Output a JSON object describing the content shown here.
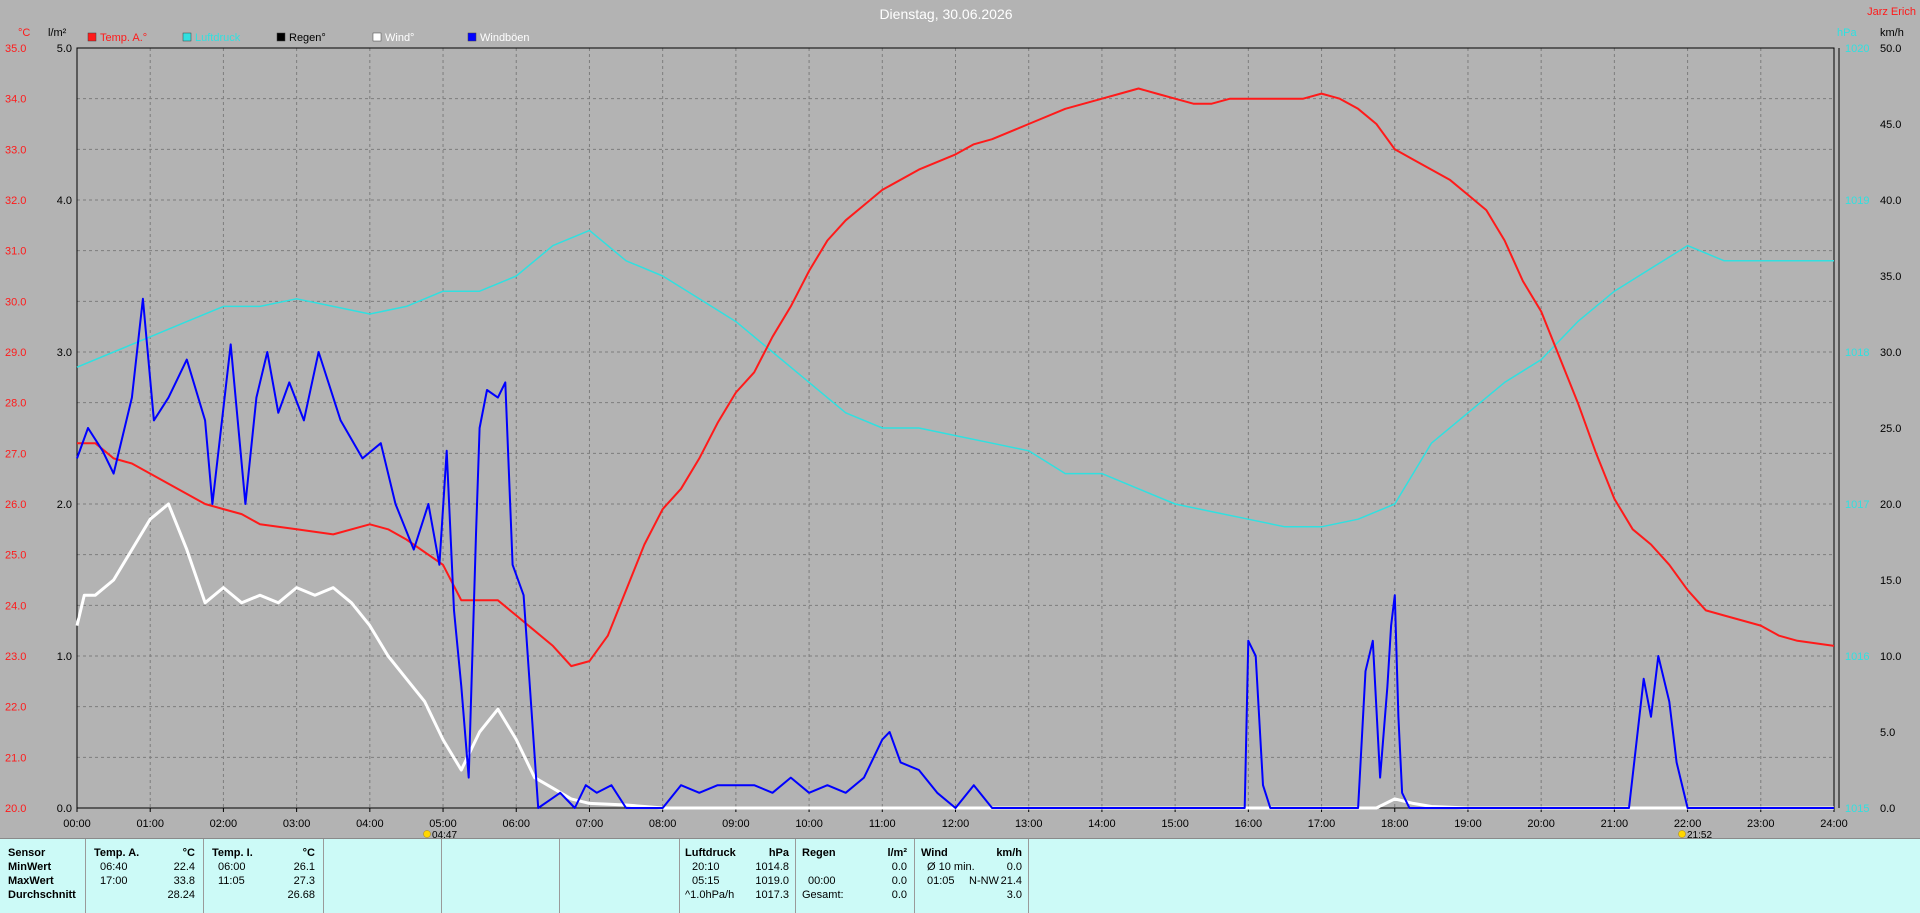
{
  "header": {
    "title": "Dienstag, 30.06.2026",
    "user": "Jarz Erich"
  },
  "legend": [
    {
      "label": "Temp. A.°",
      "color": "#ff1a1a",
      "text_color": "#ff1a1a"
    },
    {
      "label": "Luftdruck",
      "color": "#30e0e0",
      "text_color": "#30e0e0"
    },
    {
      "label": "Regen°",
      "color": "#000000",
      "text_color": "#000000"
    },
    {
      "label": "Wind°",
      "color": "#ffffff",
      "text_color": "#ffffff"
    },
    {
      "label": "Windböen",
      "color": "#0000ff",
      "text_color": "#ffffff"
    }
  ],
  "axes": {
    "left_temp_unit": "°C",
    "left_rain_unit": "l/m²",
    "right_pressure_unit": "hPa",
    "right_wind_unit": "km/h",
    "temp_ticks": [
      "35.0",
      "34.0",
      "33.0",
      "32.0",
      "31.0",
      "30.0",
      "29.0",
      "28.0",
      "27.0",
      "26.0",
      "25.0",
      "24.0",
      "23.0",
      "22.0",
      "21.0",
      "20.0"
    ],
    "rain_ticks": [
      "5.0",
      "4.0",
      "3.0",
      "2.0",
      "1.0",
      "0.0"
    ],
    "pressure_ticks": [
      "1020",
      "1019",
      "1018",
      "1017",
      "1016",
      "1015"
    ],
    "wind_ticks": [
      "50.0",
      "45.0",
      "40.0",
      "35.0",
      "30.0",
      "25.0",
      "20.0",
      "15.0",
      "10.0",
      "5.0",
      "0.0"
    ],
    "time_ticks": [
      "00:00",
      "01:00",
      "02:00",
      "03:00",
      "04:00",
      "05:00",
      "06:00",
      "07:00",
      "08:00",
      "09:00",
      "10:00",
      "11:00",
      "12:00",
      "13:00",
      "14:00",
      "15:00",
      "16:00",
      "17:00",
      "18:00",
      "19:00",
      "20:00",
      "21:00",
      "22:00",
      "23:00",
      "24:00"
    ],
    "sunrise": "04:47",
    "sunset": "21:52"
  },
  "chart_data": {
    "type": "line",
    "title": "Dienstag, 30.06.2026",
    "x_range_hours": [
      0,
      24
    ],
    "temp_range": [
      20,
      35
    ],
    "wind_range": [
      0,
      50
    ],
    "pressure_range": [
      1015,
      1020
    ],
    "rain_range": [
      0,
      5
    ],
    "grid": true,
    "series": [
      {
        "name": "Temp. A.°",
        "unit": "°C",
        "color": "#ff1a1a",
        "x": [
          0,
          0.25,
          0.5,
          0.75,
          1,
          1.25,
          1.5,
          1.75,
          2,
          2.25,
          2.5,
          3,
          3.5,
          4,
          4.25,
          4.5,
          5,
          5.25,
          5.5,
          5.75,
          6,
          6.25,
          6.5,
          6.75,
          7,
          7.25,
          7.5,
          7.75,
          8,
          8.25,
          8.5,
          8.75,
          9,
          9.25,
          9.5,
          9.75,
          10,
          10.25,
          10.5,
          10.75,
          11,
          11.5,
          12,
          12.25,
          12.5,
          13,
          13.5,
          14,
          14.25,
          14.5,
          14.75,
          15,
          15.25,
          15.5,
          15.75,
          16,
          16.25,
          16.5,
          16.75,
          17,
          17.25,
          17.5,
          17.75,
          18,
          18.25,
          18.5,
          18.75,
          19,
          19.25,
          19.5,
          19.75,
          20,
          20.25,
          20.5,
          20.75,
          21,
          21.25,
          21.5,
          21.75,
          22,
          22.25,
          22.5,
          23,
          23.25,
          23.5,
          24
        ],
        "values": [
          27.2,
          27.2,
          26.9,
          26.8,
          26.6,
          26.4,
          26.2,
          26.0,
          25.9,
          25.8,
          25.6,
          25.5,
          25.4,
          25.6,
          25.5,
          25.3,
          24.8,
          24.1,
          24.1,
          24.1,
          23.8,
          23.5,
          23.2,
          22.8,
          22.9,
          23.4,
          24.3,
          25.2,
          25.9,
          26.3,
          26.9,
          27.6,
          28.2,
          28.6,
          29.3,
          29.9,
          30.6,
          31.2,
          31.6,
          31.9,
          32.2,
          32.6,
          32.9,
          33.1,
          33.2,
          33.5,
          33.8,
          34.0,
          34.1,
          34.2,
          34.1,
          34.0,
          33.9,
          33.9,
          34.0,
          34.0,
          34.0,
          34.0,
          34.0,
          34.1,
          34.0,
          33.8,
          33.5,
          33.0,
          32.8,
          32.6,
          32.4,
          32.1,
          31.8,
          31.2,
          30.4,
          29.8,
          28.9,
          28.0,
          27.0,
          26.1,
          25.5,
          25.2,
          24.8,
          24.3,
          23.9,
          23.8,
          23.6,
          23.4,
          23.3,
          23.2
        ]
      },
      {
        "name": "Luftdruck",
        "unit": "hPa",
        "color": "#30e0e0",
        "x": [
          0,
          0.5,
          1,
          1.5,
          2,
          2.5,
          3,
          3.5,
          4,
          4.5,
          5,
          5.5,
          6,
          6.5,
          7,
          7.5,
          8,
          8.5,
          9,
          9.5,
          10,
          10.5,
          11,
          11.5,
          12,
          12.5,
          13,
          13.5,
          14,
          14.5,
          15,
          15.5,
          16,
          16.5,
          17,
          17.5,
          18,
          18.5,
          19,
          19.5,
          20,
          20.5,
          21,
          21.5,
          22,
          22.5,
          23,
          23.5,
          24
        ],
        "values": [
          1017.9,
          1018.0,
          1018.1,
          1018.2,
          1018.3,
          1018.3,
          1018.35,
          1018.3,
          1018.25,
          1018.3,
          1018.4,
          1018.4,
          1018.5,
          1018.7,
          1018.8,
          1018.6,
          1018.5,
          1018.35,
          1018.2,
          1018.0,
          1017.8,
          1017.6,
          1017.5,
          1017.5,
          1017.45,
          1017.4,
          1017.35,
          1017.2,
          1017.2,
          1017.1,
          1017.0,
          1016.95,
          1016.9,
          1016.85,
          1016.85,
          1016.9,
          1017.0,
          1017.4,
          1017.6,
          1017.8,
          1017.95,
          1018.2,
          1018.4,
          1018.55,
          1018.7,
          1018.6,
          1018.6,
          1018.6,
          1018.6
        ]
      },
      {
        "name": "Wind°",
        "unit": "km/h",
        "color": "#ffffff",
        "x": [
          0,
          0.1,
          0.25,
          0.5,
          0.75,
          1,
          1.25,
          1.5,
          1.75,
          2,
          2.25,
          2.5,
          2.75,
          3,
          3.25,
          3.5,
          3.75,
          4,
          4.25,
          4.5,
          4.75,
          5,
          5.25,
          5.5,
          5.75,
          6,
          6.25,
          6.5,
          6.75,
          7,
          7.5,
          8,
          10,
          12,
          14,
          16,
          17,
          17.75,
          18,
          18.25,
          18.5,
          19,
          24
        ],
        "values": [
          12,
          14,
          14,
          15,
          17,
          19,
          20,
          17,
          13.5,
          14.5,
          13.5,
          14,
          13.5,
          14.5,
          14,
          14.5,
          13.5,
          12,
          10,
          8.5,
          7,
          4.5,
          2.5,
          5,
          6.5,
          4.5,
          2,
          1.3,
          0.6,
          0.3,
          0.2,
          0,
          0,
          0,
          0,
          0,
          0,
          0,
          0.6,
          0.3,
          0.1,
          0,
          0
        ]
      },
      {
        "name": "Windböen",
        "unit": "km/h",
        "color": "#0000ff",
        "x": [
          0,
          0.15,
          0.35,
          0.5,
          0.75,
          0.9,
          1.05,
          1.25,
          1.5,
          1.75,
          1.85,
          2.1,
          2.3,
          2.45,
          2.6,
          2.75,
          2.9,
          3.1,
          3.3,
          3.6,
          3.9,
          4.15,
          4.35,
          4.6,
          4.8,
          4.95,
          5.05,
          5.15,
          5.25,
          5.35,
          5.45,
          5.5,
          5.6,
          5.75,
          5.85,
          5.95,
          6.1,
          6.3,
          6.45,
          6.6,
          6.8,
          6.95,
          7.1,
          7.3,
          7.5,
          7.7,
          8,
          8.25,
          8.5,
          8.75,
          9,
          9.25,
          9.5,
          9.75,
          10,
          10.25,
          10.5,
          10.75,
          11,
          11.1,
          11.25,
          11.5,
          11.75,
          12,
          12.25,
          12.5,
          12.75,
          13,
          14,
          15,
          15.95,
          16,
          16.1,
          16.2,
          16.3,
          17.5,
          17.6,
          17.7,
          17.8,
          17.9,
          17.95,
          18,
          18.05,
          18.1,
          18.2,
          18.5,
          20,
          21,
          21.2,
          21.4,
          21.5,
          21.6,
          21.75,
          21.85,
          22,
          24
        ],
        "values": [
          23,
          25,
          23.5,
          22,
          27,
          33.5,
          25.5,
          27,
          29.5,
          25.5,
          20,
          30.5,
          20,
          27,
          30,
          26,
          28,
          25.5,
          30,
          25.5,
          23,
          24,
          20,
          17,
          20,
          16,
          23.5,
          13,
          8,
          2,
          18,
          25,
          27.5,
          27,
          28,
          16,
          14,
          0,
          0.5,
          1,
          0,
          1.5,
          1,
          1.5,
          0,
          0,
          0,
          1.5,
          1,
          1.5,
          1.5,
          1.5,
          1,
          2,
          1,
          1.5,
          1,
          2,
          4.5,
          5,
          3,
          2.5,
          1,
          0,
          1.5,
          0,
          0,
          0,
          0,
          0,
          0,
          11,
          10,
          1.5,
          0,
          0,
          9,
          11,
          2,
          8,
          12,
          14,
          6,
          1,
          0,
          0,
          0,
          0,
          0,
          8.5,
          6,
          10,
          7,
          3,
          0,
          0
        ]
      },
      {
        "name": "Regen°",
        "unit": "l/m²",
        "color": "#000000",
        "x": [
          0,
          24
        ],
        "values": [
          0,
          0
        ]
      }
    ]
  },
  "summary": {
    "sensor": {
      "title": "Sensor",
      "rows": [
        "MinWert",
        "MaxWert",
        "Durchschnitt"
      ]
    },
    "temp_a": {
      "title": "Temp. A.",
      "unit": "°C",
      "rows": [
        {
          "time": "06:40",
          "value": "22.4"
        },
        {
          "time": "17:00",
          "value": "33.8"
        },
        {
          "time": "",
          "value": "28.24"
        }
      ]
    },
    "temp_i": {
      "title": "Temp. I.",
      "unit": "°C",
      "rows": [
        {
          "time": "06:00",
          "value": "26.1"
        },
        {
          "time": "11:05",
          "value": "27.3"
        },
        {
          "time": "",
          "value": "26.68"
        }
      ]
    },
    "pressure": {
      "title": "Luftdruck",
      "unit": "hPa",
      "rows": [
        {
          "time": "20:10",
          "value": "1014.8"
        },
        {
          "time": "05:15",
          "value": "1019.0"
        },
        {
          "time": "^1.0hPa/h",
          "value": "1017.3"
        }
      ]
    },
    "rain": {
      "title": "Regen",
      "unit": "l/m²",
      "rows": [
        {
          "time": "",
          "value": "0.0"
        },
        {
          "time": "00:00",
          "value": "0.0"
        },
        {
          "time": "Gesamt:",
          "value": "0.0"
        }
      ]
    },
    "wind": {
      "title": "Wind",
      "unit": "km/h",
      "rows": [
        {
          "time": "Ø 10 min.",
          "value": "0.0"
        },
        {
          "time": "01:05",
          "dir": "N-NW",
          "value": "21.4"
        },
        {
          "time": "",
          "value": "3.0"
        }
      ]
    }
  }
}
